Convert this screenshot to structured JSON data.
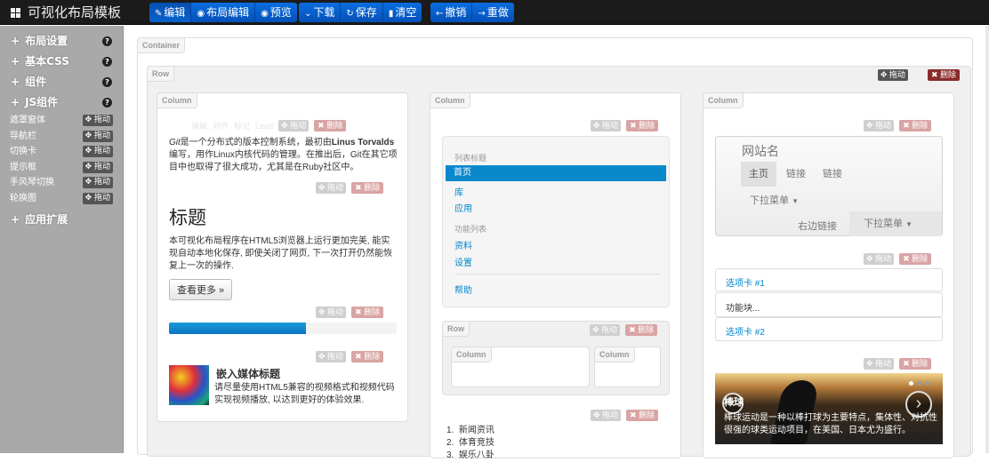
{
  "app": {
    "title": "可视化布局模板"
  },
  "toolbar": {
    "edit": "编辑",
    "layout_edit": "布局编辑",
    "preview": "预览",
    "download": "下载",
    "save": "保存",
    "clear": "清空",
    "undo": "撤销",
    "redo": "重做"
  },
  "sidebar": {
    "layout_settings": "布局设置",
    "basic_css": "基本CSS",
    "components": "组件",
    "js_components": "JS组件",
    "js_items": [
      "遮罩窗体",
      "导航栏",
      "切换卡",
      "提示框",
      "手风琴切换",
      "轮换图"
    ],
    "app_extensions": "应用扩展",
    "drag_label": "拖动",
    "help": "?"
  },
  "labels": {
    "container": "Container",
    "row": "Row",
    "column": "Column",
    "drag": "拖动",
    "delete": "删除"
  },
  "ghost_menu": {
    "edit": "编辑",
    "align": "对齐",
    "mark": "标记",
    "lead": "Lead"
  },
  "col1": {
    "paragraph_prefix": "Git",
    "paragraph_mid": "是一个分布式的版本控制系统，最初由",
    "paragraph_bold": "Linus Torvalds",
    "paragraph_rest": "编写，用作Linux内核代码的管理。在推出后，Git在其它项目中也取得了很大成功，尤其是在Ruby社区中。",
    "hero_title": "标题",
    "hero_text": "本可视化布局程序在HTML5浏览器上运行更加完美, 能实现自动本地化保存, 即使关闭了网页, 下一次打开仍然能恢复上一次的操作.",
    "more_button": "查看更多 »",
    "progress": 0.6,
    "media_title": "嵌入媒体标题",
    "media_text": "请尽量使用HTML5兼容的视频格式和视频代码实现视频播放, 以达到更好的体验效果."
  },
  "col2": {
    "list_header": "列表标题",
    "items": [
      "首页",
      "库",
      "应用"
    ],
    "feature_header": "功能列表",
    "feature_items": [
      "资料",
      "设置"
    ],
    "help": "帮助",
    "ol": [
      "新闻资讯",
      "体育竞技",
      "娱乐八卦"
    ]
  },
  "col3": {
    "site_name": "网站名",
    "nav": [
      "主页",
      "链接",
      "链接"
    ],
    "dropdown": "下拉菜单",
    "right_link": "右边链接",
    "right_dropdown": "下拉菜单",
    "tab1": "选项卡 #1",
    "tab_content": "功能块...",
    "tab2": "选项卡 #2",
    "carousel_title": "棒球",
    "carousel_text": "棒球运动是一种以棒打球为主要特点，集体性、对抗性很强的球类运动项目，在美国、日本尤为盛行。"
  },
  "colors": {
    "toolbar_blue": "#0a62cc",
    "sidebar": "#a9a9a9",
    "active_nav": "#0a88cc"
  }
}
